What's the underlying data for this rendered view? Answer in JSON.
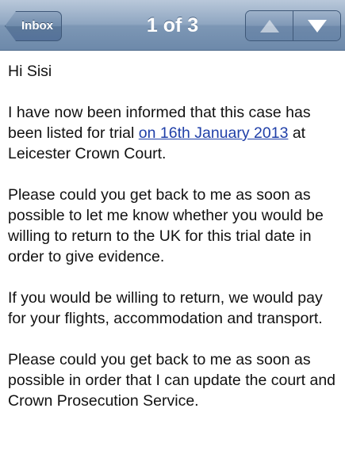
{
  "navbar": {
    "back_label": "Inbox",
    "title": "1 of 3",
    "prev_icon": "up-arrow-icon",
    "next_icon": "down-arrow-icon"
  },
  "message": {
    "greeting": "Hi Sisi",
    "p1_before": "I have now been informed that this case has been listed for trial ",
    "p1_link": "on 16th January 2013",
    "p1_after": " at Leicester Crown Court.",
    "p2": "Please could you get back to me as soon as possible to let me know whether you would be willing to return to the UK for this trial date in order to give evidence.",
    "p3": "If you would be willing to return, we would pay for your flights, accommodation and transport.",
    "p4": "Please could you get back to me as soon as possible in order that I can update the court and Crown Prosecution Service."
  },
  "colors": {
    "navbar": "#7d97b5",
    "link": "#1f3fa8"
  }
}
